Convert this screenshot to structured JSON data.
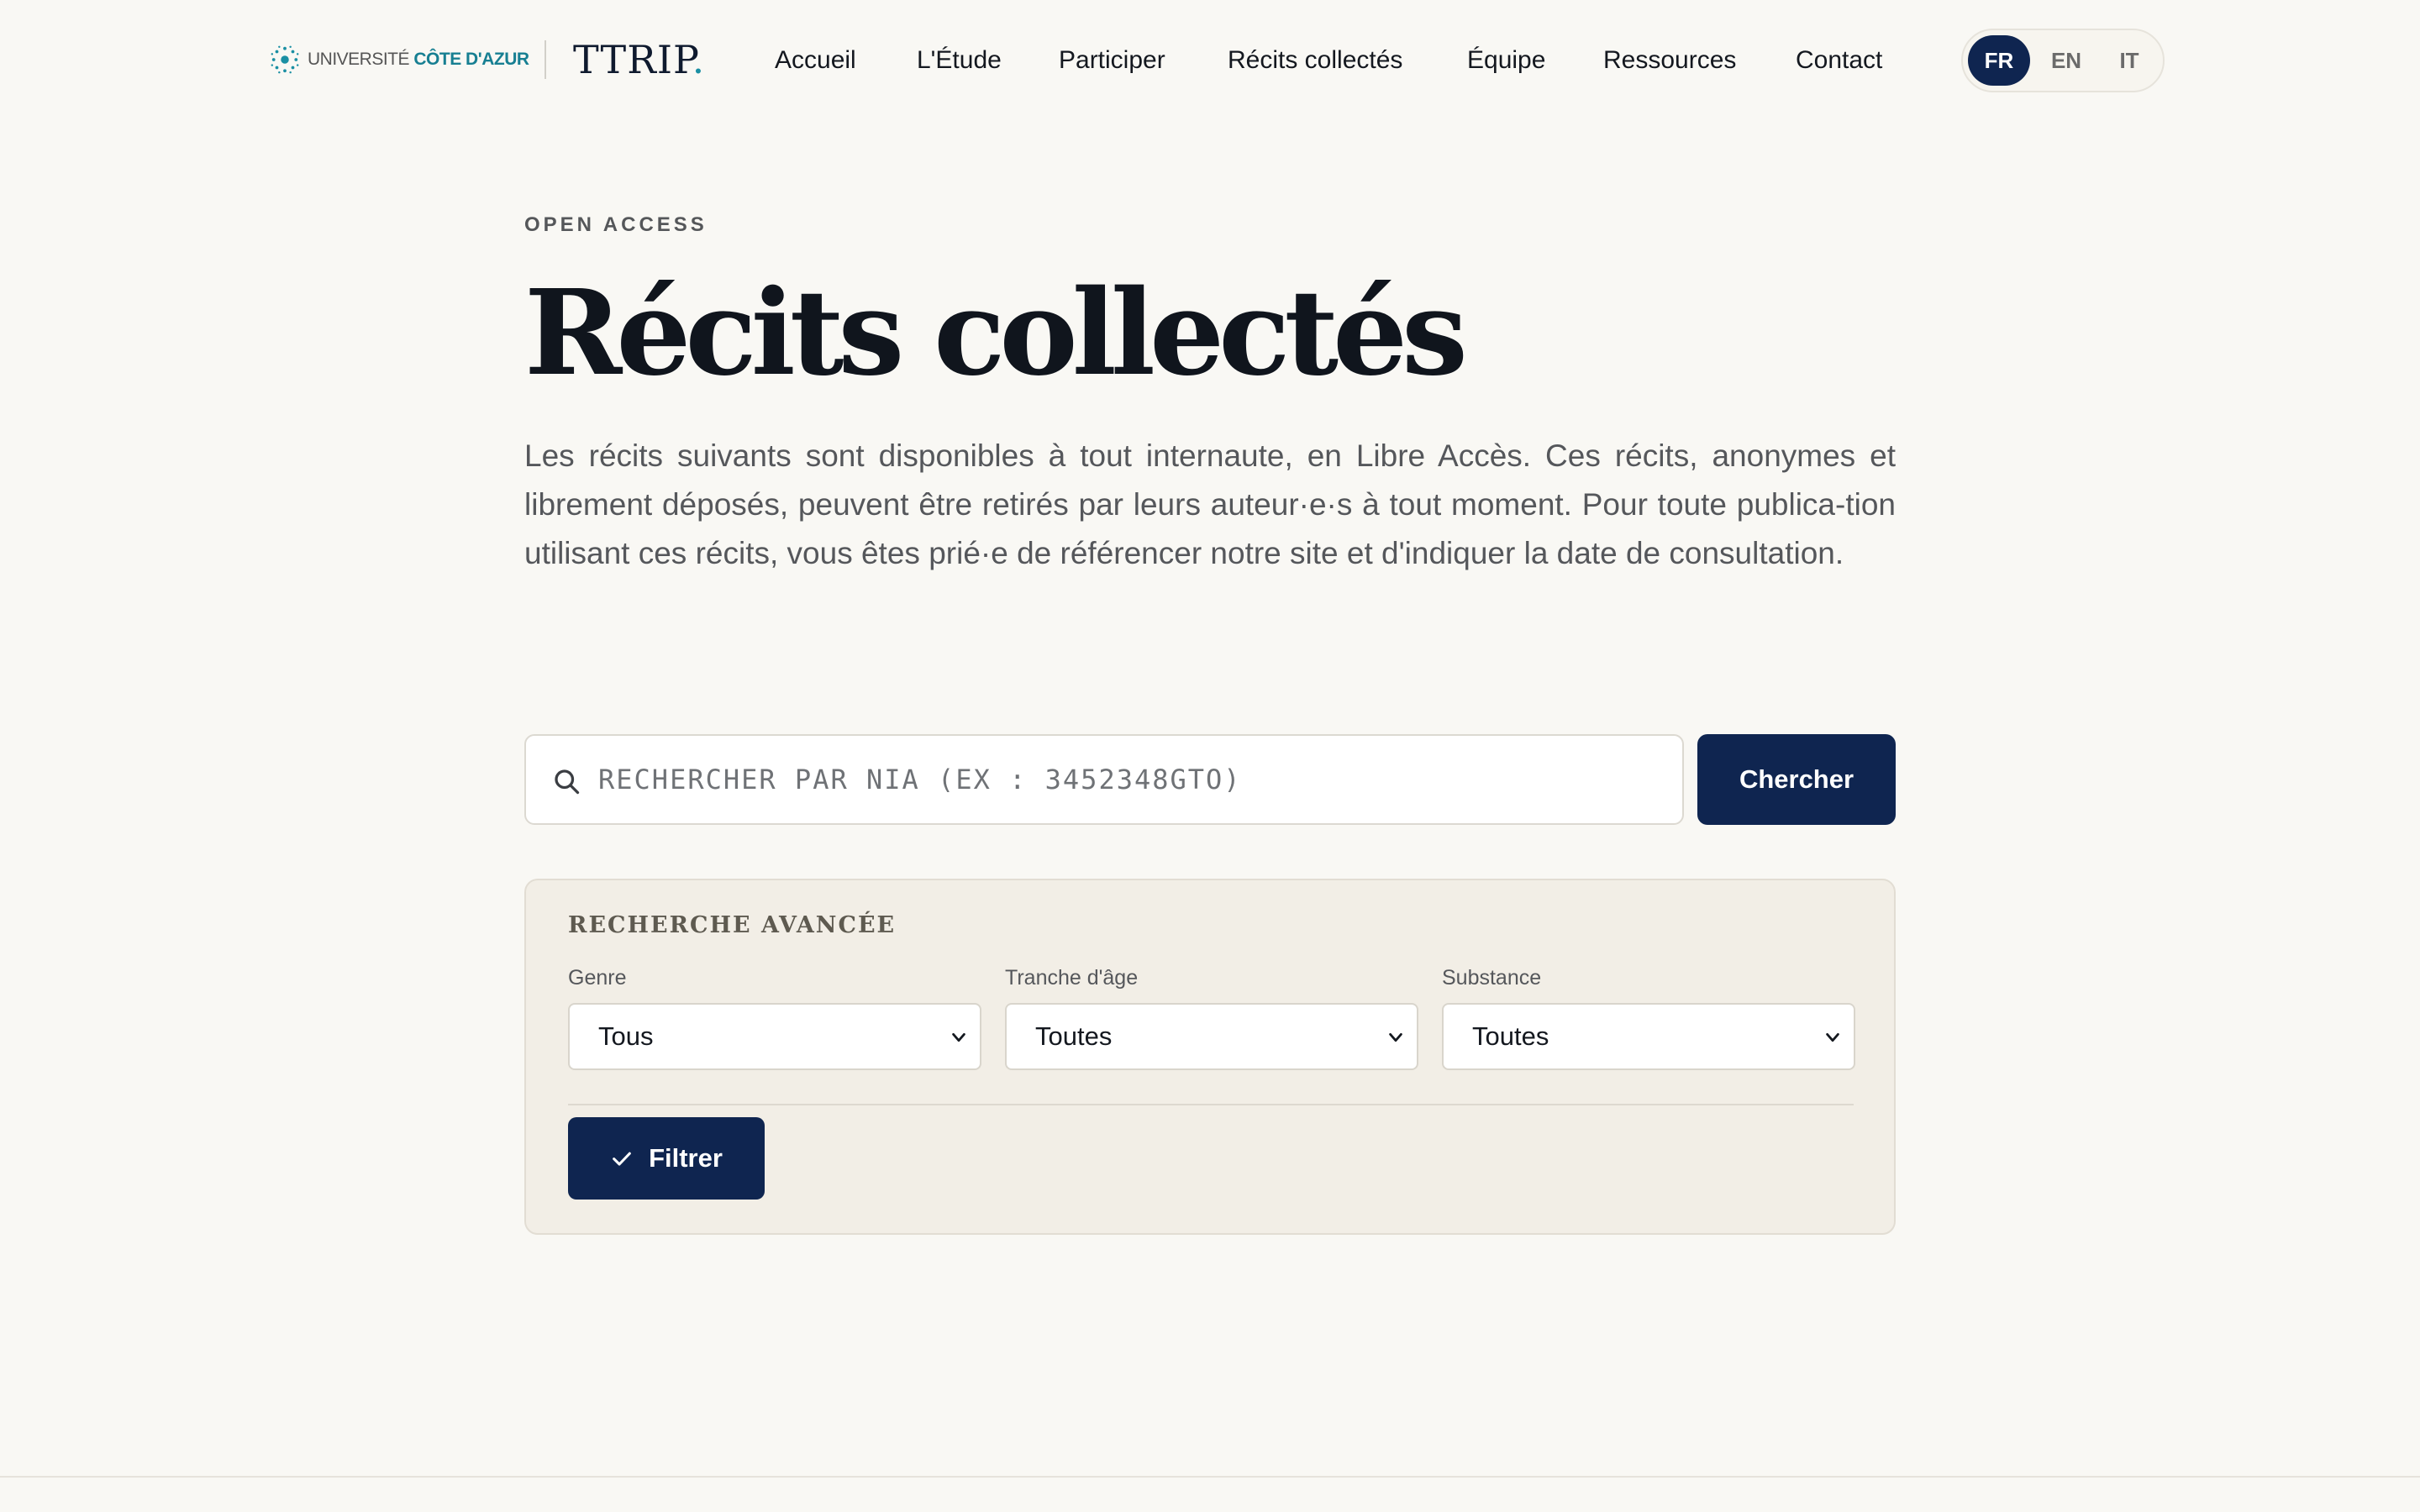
{
  "header": {
    "university": {
      "prefix": "UNIVERSITÉ",
      "name": "CÔTE D'AZUR"
    },
    "brand": {
      "name": "TTRIP",
      "dot": "."
    },
    "nav": [
      {
        "label": "Accueil"
      },
      {
        "label": "L'Étude"
      },
      {
        "label": "Participer"
      },
      {
        "label": "Récits collectés"
      },
      {
        "label": "Équipe"
      },
      {
        "label": "Ressources"
      },
      {
        "label": "Contact"
      }
    ],
    "languages": [
      {
        "code": "FR",
        "active": true
      },
      {
        "code": "EN",
        "active": false
      },
      {
        "code": "IT",
        "active": false
      }
    ]
  },
  "hero": {
    "eyebrow": "OPEN ACCESS",
    "title": "Récits collectés",
    "intro": "Les récits suivants sont disponibles à tout internaute, en Libre Accès. Ces récits, anonymes et librement déposés, peuvent être retirés par leurs auteur·e·s à tout moment. Pour toute publica-tion utilisant ces récits, vous êtes prié·e de référencer notre site et d'indiquer la date de consultation."
  },
  "search": {
    "placeholder": "RECHERCHER PAR NIA (EX : 3452348GTO)",
    "value": "",
    "button_label": "Chercher"
  },
  "advanced": {
    "title": "RECHERCHE AVANCÉE",
    "fields": [
      {
        "label": "Genre",
        "value": "Tous"
      },
      {
        "label": "Tranche d'âge",
        "value": "Toutes"
      },
      {
        "label": "Substance",
        "value": "Toutes"
      }
    ],
    "filter_label": "Filtrer"
  },
  "colors": {
    "background": "#f9f8f4",
    "primary": "#0f2550",
    "accent": "#177f92",
    "panel": "#f2eee6"
  },
  "icons": {
    "search": "search-icon",
    "chevron": "chevron-down-icon",
    "check": "check-icon",
    "university": "university-logo-icon"
  }
}
